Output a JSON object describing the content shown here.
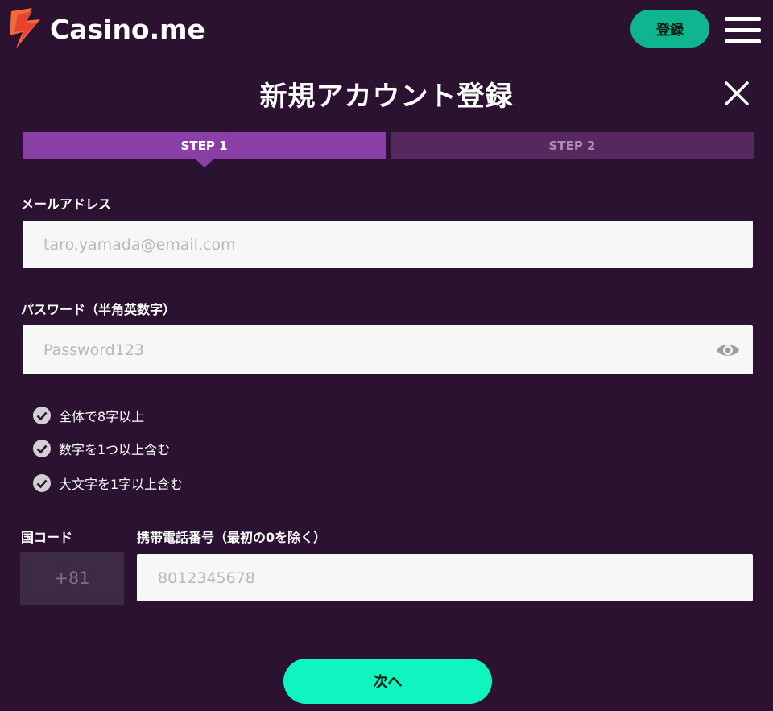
{
  "header": {
    "logo_text": "Casino.me",
    "register_label": "登録",
    "menu_icon": "hamburger-menu-icon"
  },
  "title": "新規アカウント登録",
  "close_icon": "close-icon",
  "steps": [
    {
      "label": "STEP 1",
      "active": true
    },
    {
      "label": "STEP 2",
      "active": false
    }
  ],
  "email": {
    "label": "メールアドレス",
    "placeholder": "taro.yamada@email.com",
    "value": ""
  },
  "password": {
    "label": "パスワード（半角英数字）",
    "placeholder": "Password123",
    "value": "",
    "toggle_icon": "eye-icon"
  },
  "password_rules": [
    "全体で8字以上",
    "数字を1つ以上含む",
    "大文字を1字以上含む"
  ],
  "country_code": {
    "label": "国コード",
    "value": "+81"
  },
  "phone": {
    "label": "携帯電話番号（最初の0を除く）",
    "placeholder": "8012345678",
    "value": ""
  },
  "next_label": "次へ",
  "colors": {
    "background": "#2a1230",
    "step_active": "#8a3fa6",
    "step_inactive": "#57275f",
    "register_button": "#0fb58f",
    "next_button": "#0ef5c0"
  }
}
